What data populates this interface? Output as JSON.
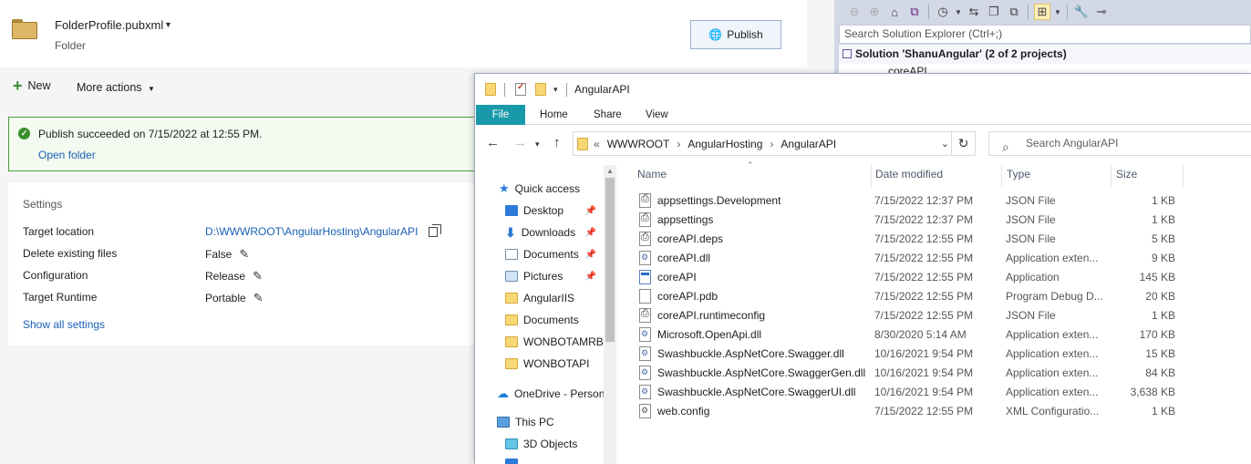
{
  "vs": {
    "profile_name": "FolderProfile.pubxml",
    "profile_type": "Folder",
    "publish_label": "Publish",
    "new_label": "New",
    "more_actions_label": "More actions",
    "success_message": "Publish succeeded on 7/15/2022 at 12:55 PM.",
    "open_folder_label": "Open folder",
    "settings_title": "Settings",
    "settings": [
      {
        "label": "Target location",
        "value": "D:\\WWWROOT\\AngularHosting\\AngularAPI"
      },
      {
        "label": "Delete existing files",
        "value": "False"
      },
      {
        "label": "Configuration",
        "value": "Release"
      },
      {
        "label": "Target Runtime",
        "value": "Portable"
      }
    ],
    "show_all_label": "Show all settings"
  },
  "solution_explorer": {
    "search_placeholder": "Search Solution Explorer (Ctrl+;)",
    "solution_label": "Solution 'ShanuAngular' (2 of 2 projects)",
    "project_label": "coreAPI"
  },
  "explorer": {
    "title": "AngularAPI",
    "ribbon_tabs": [
      "File",
      "Home",
      "Share",
      "View"
    ],
    "breadcrumb_prefix": "«",
    "breadcrumb": [
      "WWWROOT",
      "AngularHosting",
      "AngularAPI"
    ],
    "search_placeholder": "Search AngularAPI",
    "nav": [
      {
        "label": "Quick access",
        "icon": "star-icon"
      },
      {
        "label": "Desktop",
        "icon": "desktop-icon",
        "pinned": true
      },
      {
        "label": "Downloads",
        "icon": "download-icon",
        "pinned": true
      },
      {
        "label": "Documents",
        "icon": "documents-icon",
        "pinned": true
      },
      {
        "label": "Pictures",
        "icon": "pictures-icon",
        "pinned": true
      },
      {
        "label": "AngularIIS",
        "icon": "folder-icon"
      },
      {
        "label": "Documents",
        "icon": "folder-icon"
      },
      {
        "label": "WONBOTAMRBU",
        "icon": "folder-icon"
      },
      {
        "label": "WONBOTAPI",
        "icon": "folder-icon"
      },
      {
        "label": "OneDrive - Person",
        "icon": "cloud-icon"
      },
      {
        "label": "This PC",
        "icon": "pc-icon"
      },
      {
        "label": "3D Objects",
        "icon": "cube-icon"
      }
    ],
    "columns": {
      "name": "Name",
      "date": "Date modified",
      "type": "Type",
      "size": "Size"
    },
    "files": [
      {
        "name": "appsettings.Development",
        "date": "7/15/2022 12:37 PM",
        "type": "JSON File",
        "size": "1 KB",
        "icon": "json"
      },
      {
        "name": "appsettings",
        "date": "7/15/2022 12:37 PM",
        "type": "JSON File",
        "size": "1 KB",
        "icon": "json"
      },
      {
        "name": "coreAPI.deps",
        "date": "7/15/2022 12:55 PM",
        "type": "JSON File",
        "size": "5 KB",
        "icon": "json"
      },
      {
        "name": "coreAPI.dll",
        "date": "7/15/2022 12:55 PM",
        "type": "Application exten...",
        "size": "9 KB",
        "icon": "dll"
      },
      {
        "name": "coreAPI",
        "date": "7/15/2022 12:55 PM",
        "type": "Application",
        "size": "145 KB",
        "icon": "exe"
      },
      {
        "name": "coreAPI.pdb",
        "date": "7/15/2022 12:55 PM",
        "type": "Program Debug D...",
        "size": "20 KB",
        "icon": "blank"
      },
      {
        "name": "coreAPI.runtimeconfig",
        "date": "7/15/2022 12:55 PM",
        "type": "JSON File",
        "size": "1 KB",
        "icon": "json"
      },
      {
        "name": "Microsoft.OpenApi.dll",
        "date": "8/30/2020 5:14 AM",
        "type": "Application exten...",
        "size": "170 KB",
        "icon": "dll"
      },
      {
        "name": "Swashbuckle.AspNetCore.Swagger.dll",
        "date": "10/16/2021 9:54 PM",
        "type": "Application exten...",
        "size": "15 KB",
        "icon": "dll"
      },
      {
        "name": "Swashbuckle.AspNetCore.SwaggerGen.dll",
        "date": "10/16/2021 9:54 PM",
        "type": "Application exten...",
        "size": "84 KB",
        "icon": "dll"
      },
      {
        "name": "Swashbuckle.AspNetCore.SwaggerUI.dll",
        "date": "10/16/2021 9:54 PM",
        "type": "Application exten...",
        "size": "3,638 KB",
        "icon": "dll"
      },
      {
        "name": "web.config",
        "date": "7/15/2022 12:55 PM",
        "type": "XML Configuratio...",
        "size": "1 KB",
        "icon": "cfg"
      }
    ]
  },
  "colors": {
    "accent_file_tab": "#199aaa",
    "success_green": "#3a8f2b",
    "link_blue": "#1a5fb4"
  }
}
